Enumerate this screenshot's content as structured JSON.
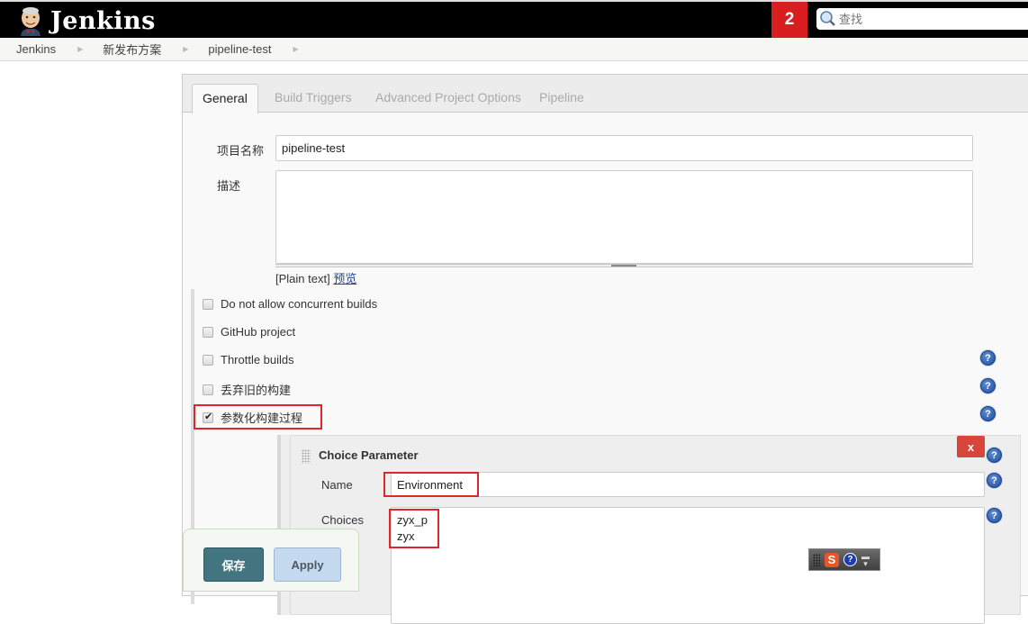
{
  "header": {
    "logo_text": "Jenkins",
    "notification_count": "2",
    "search_placeholder": "查找"
  },
  "breadcrumb": [
    {
      "label": "Jenkins"
    },
    {
      "label": "新发布方案"
    },
    {
      "label": "pipeline-test"
    }
  ],
  "tabs": [
    {
      "label": "General",
      "active": true
    },
    {
      "label": "Build Triggers",
      "active": false
    },
    {
      "label": "Advanced Project Options",
      "active": false
    },
    {
      "label": "Pipeline",
      "active": false
    }
  ],
  "form": {
    "project_name_label": "项目名称",
    "project_name_value": "pipeline-test",
    "description_label": "描述",
    "description_value": "",
    "plain_text_label": "[Plain text]",
    "preview_link": "预览"
  },
  "options": [
    {
      "label": "Do not allow concurrent builds",
      "checked": false,
      "help": false
    },
    {
      "label": "GitHub project",
      "checked": false,
      "help": false
    },
    {
      "label": "Throttle builds",
      "checked": false,
      "help": true
    },
    {
      "label": "丢弃旧的构建",
      "checked": false,
      "help": true
    },
    {
      "label": "参数化构建过程",
      "checked": true,
      "help": true
    }
  ],
  "choice_parameter": {
    "title": "Choice Parameter",
    "delete_label": "x",
    "name_label": "Name",
    "name_value": "Environment",
    "choices_label": "Choices",
    "choices_value": "zyx_p\nzyx"
  },
  "buttons": {
    "save": "保存",
    "apply": "Apply"
  },
  "ime_toolbar": {
    "s_label": "S",
    "help_label": "?"
  },
  "colors": {
    "header_bg": "#000000",
    "badge": "#d81e1e",
    "highlight": "#e0262b",
    "save_button": "#437580",
    "apply_button": "#c5d9ef",
    "delete_button": "#d9453a",
    "link": "#204a87"
  }
}
